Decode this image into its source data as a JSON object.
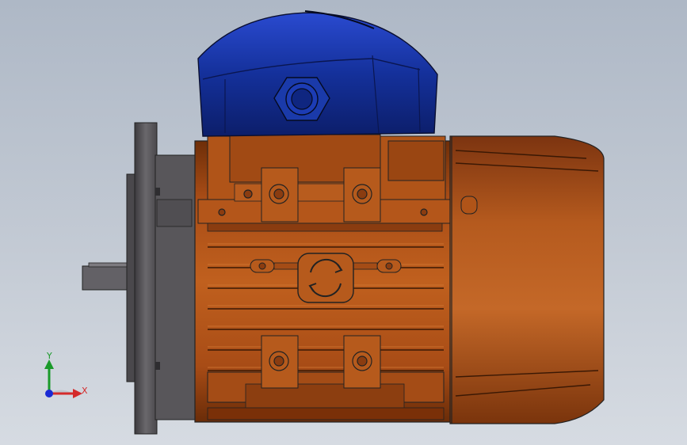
{
  "viewport": {
    "background_top": "#aeb8c6",
    "background_bottom": "#d6dbe2"
  },
  "model": {
    "part_colors": {
      "terminal_box_cover": "#14309a",
      "motor_body": "#b8561a",
      "motor_body_shadow": "#7a340c",
      "flange": "#5c5a5d",
      "shaft": "#6a686c"
    },
    "rotation_symbol": "rotate-arrows-icon"
  },
  "triad": {
    "axis_y_label": "Y",
    "axis_x_label": "X",
    "colors": {
      "y": "#1a9a2a",
      "x": "#d42a2a",
      "z": "#1a2ad4"
    }
  }
}
